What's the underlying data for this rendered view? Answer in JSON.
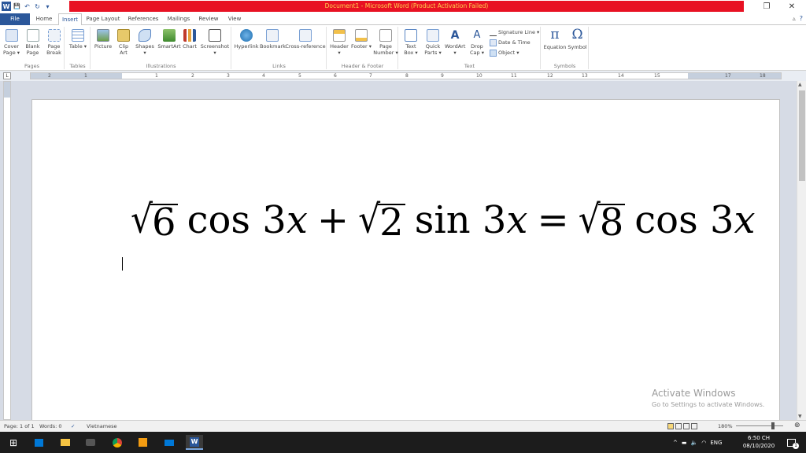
{
  "window": {
    "title": "Document1 - Microsoft Word (Product Activation Failed)",
    "restore_glyph": "❐",
    "close_glyph": "✕"
  },
  "qat": {
    "word_logo": "W",
    "save_glyph": "💾",
    "undo_glyph": "↶",
    "redo_glyph": "↻",
    "customize_glyph": "▾"
  },
  "tabs": [
    {
      "label": "File"
    },
    {
      "label": "Home"
    },
    {
      "label": "Insert"
    },
    {
      "label": "Page Layout"
    },
    {
      "label": "References"
    },
    {
      "label": "Mailings"
    },
    {
      "label": "Review"
    },
    {
      "label": "View"
    }
  ],
  "ribbon": {
    "pages": {
      "label": "Pages",
      "cover": "Cover Page ▾",
      "blank": "Blank Page",
      "break": "Page Break"
    },
    "tables": {
      "label": "Tables",
      "table": "Table ▾"
    },
    "illustrations": {
      "label": "Illustrations",
      "picture": "Picture",
      "clipart": "Clip Art",
      "shapes": "Shapes ▾",
      "smartart": "SmartArt",
      "chart": "Chart",
      "screenshot": "Screenshot ▾"
    },
    "links": {
      "label": "Links",
      "hyperlink": "Hyperlink",
      "bookmark": "Bookmark",
      "crossref": "Cross-reference"
    },
    "headerfooter": {
      "label": "Header & Footer",
      "header": "Header ▾",
      "footer": "Footer ▾",
      "pagenumber": "Page Number ▾"
    },
    "text": {
      "label": "Text",
      "textbox": "Text Box ▾",
      "quickparts": "Quick Parts ▾",
      "wordart": "WordArt ▾",
      "dropcap": "Drop Cap ▾",
      "signature": "Signature Line ▾",
      "datetime": "Date & Time",
      "object": "Object ▾"
    },
    "symbols": {
      "label": "Symbols",
      "equation": "Equation",
      "symbol": "Symbol",
      "pi": "π",
      "omega": "Ω"
    }
  },
  "ruler": {
    "corner": "L",
    "ticks": [
      "2",
      "1",
      "1",
      "2",
      "3",
      "4",
      "5",
      "6",
      "7",
      "8",
      "9",
      "10",
      "11",
      "12",
      "13",
      "14",
      "15",
      "17",
      "18"
    ]
  },
  "document": {
    "equation": {
      "r1": "6",
      "t1": "cos 3",
      "v1": "x",
      "plus": "+",
      "r2": "2",
      "t2": "sin 3",
      "v2": "x",
      "eq": "=",
      "r3": "8",
      "t3": "cos 3",
      "v3": "x"
    }
  },
  "watermark": {
    "line1": "Activate Windows",
    "line2": "Go to Settings to activate Windows."
  },
  "status": {
    "page": "Page: 1 of 1",
    "words": "Words: 0",
    "language": "Vietnamese",
    "zoom": "180%"
  },
  "taskbar": {
    "start_glyph": "⊞",
    "tray_language": "ENG",
    "time": "6:50 CH",
    "date": "08/10/2020",
    "notification_count": "1"
  }
}
